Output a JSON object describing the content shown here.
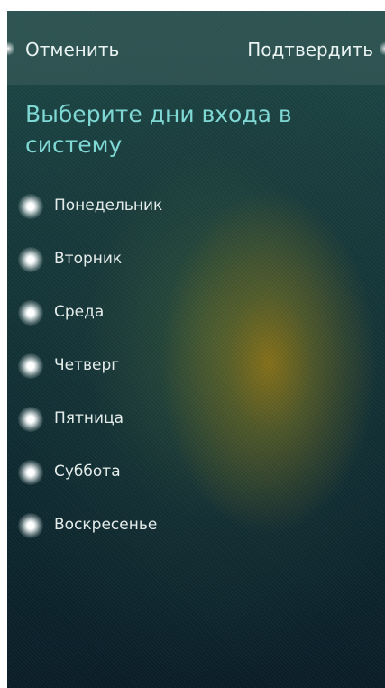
{
  "header": {
    "cancel_label": "Отменить",
    "confirm_label": "Подтвердить"
  },
  "title": "Выберите дни входа в систему",
  "days": [
    {
      "label": "Понедельник"
    },
    {
      "label": "Вторник"
    },
    {
      "label": "Среда"
    },
    {
      "label": "Четверг"
    },
    {
      "label": "Пятница"
    },
    {
      "label": "Суббота"
    },
    {
      "label": "Воскресенье"
    }
  ],
  "icons": {
    "day_selector": "radio-dot-icon"
  },
  "colors": {
    "title": "#7fd8d4",
    "text": "#e4ecea",
    "header_bar": "#3c5f5c"
  }
}
